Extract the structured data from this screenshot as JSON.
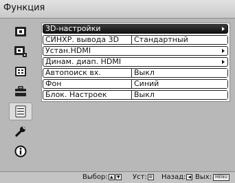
{
  "title": "Функция",
  "sidebar": {
    "items": [
      {
        "icon": "input-source-icon"
      },
      {
        "icon": "picture-settings-icon"
      },
      {
        "icon": "screen-icon"
      },
      {
        "icon": "setup-icon"
      },
      {
        "icon": "function-icon",
        "selected": true
      },
      {
        "icon": "wrench-icon"
      },
      {
        "icon": "info-icon"
      }
    ]
  },
  "menu": {
    "rows": [
      {
        "label": "3D-настройки",
        "value": "",
        "arrow": true,
        "highlight": true
      },
      {
        "label": "СИНХР. вывода 3D",
        "value": "Стандартный"
      },
      {
        "label": "Устан.HDMI",
        "value": "",
        "arrow": true
      },
      {
        "label": "Динам. диап. HDMI",
        "value": "",
        "arrow": true
      },
      {
        "label": "Автопоиск вх.",
        "value": "Выкл"
      },
      {
        "label": "Фон",
        "value": "Синий"
      },
      {
        "label": "Блок. Настроек",
        "value": "Выкл"
      }
    ]
  },
  "footer": {
    "select_label": "Выбор:",
    "set_label": "Уст:",
    "back_label": "Назад:",
    "exit_label": "Вых:",
    "menu_key": "MENU"
  }
}
